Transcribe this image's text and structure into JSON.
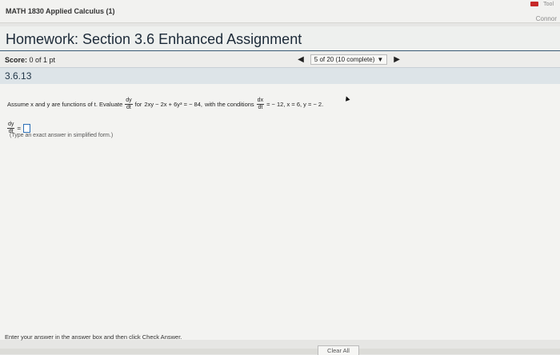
{
  "header": {
    "course": "MATH 1830 Applied Calculus (1)",
    "user": "Connor",
    "top_right_label": "Tool"
  },
  "assignment": {
    "title": "Homework: Section 3.6 Enhanced Assignment",
    "score_label": "Score:",
    "score_value": "0 of 1 pt",
    "progress": "5 of 20 (10 complete)",
    "question_id": "3.6.13"
  },
  "problem": {
    "intro": "Assume x and y are functions of t. Evaluate",
    "dy": "dy",
    "dt": "dt",
    "for_text": "for",
    "equation": "2xy − 2x + 6y³ = − 84,",
    "with_text": "with the conditions",
    "dx": "dx",
    "conditions": "= − 12, x = 6, y = − 2."
  },
  "answer": {
    "equals": "=",
    "hint": "(Type an exact answer in simplified form.)"
  },
  "footer": {
    "instructions": "Enter your answer in the answer box and then click Check Answer.",
    "clear_all": "Clear All"
  },
  "colors": {
    "accent": "#3b5b75",
    "answer_border": "#2c6fb6"
  }
}
